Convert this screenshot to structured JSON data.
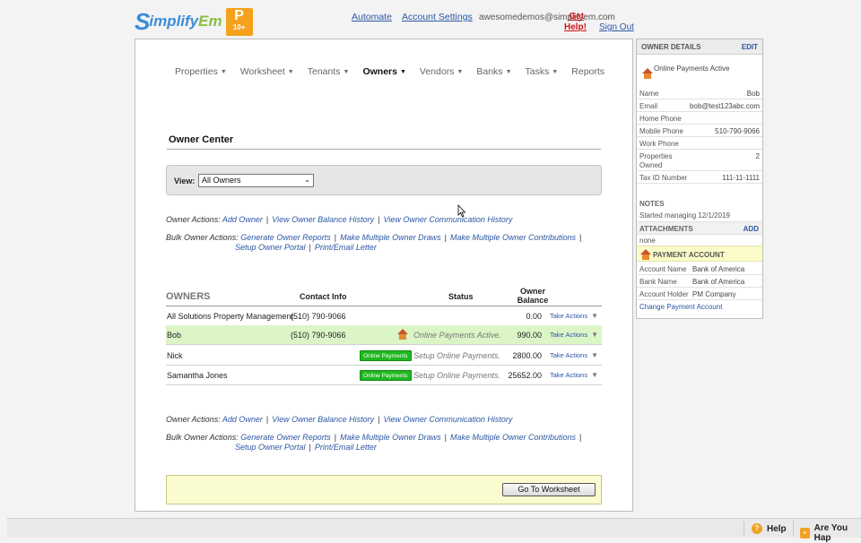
{
  "header": {
    "logo_s": "S",
    "logo_text_main": "implify",
    "logo_text_em": "Em",
    "badge_big": "P",
    "badge_small": "10+",
    "links": {
      "automate": "Automate",
      "account_settings": "Account Settings",
      "user_email": "awesomedemos@simplifyem.com",
      "get": "Get",
      "help": "Help!",
      "sign_out": "Sign Out"
    }
  },
  "menu": [
    {
      "label": "Properties",
      "caret": true
    },
    {
      "label": "Worksheet",
      "caret": true
    },
    {
      "label": "Tenants",
      "caret": true
    },
    {
      "label": "Owners",
      "caret": true,
      "active": true
    },
    {
      "label": "Vendors",
      "caret": true
    },
    {
      "label": "Banks",
      "caret": true
    },
    {
      "label": "Tasks",
      "caret": true
    },
    {
      "label": "Reports",
      "caret": false
    }
  ],
  "page": {
    "title": "Owner Center",
    "view_label": "View:",
    "view_value": "All Owners"
  },
  "owner_actions": {
    "label": "Owner Actions:",
    "links": [
      "Add Owner",
      "View Owner Balance History",
      "View Owner Communication History"
    ]
  },
  "bulk_actions": {
    "label": "Bulk Owner Actions:",
    "line1": [
      "Generate Owner Reports",
      "Make Multiple Owner Draws",
      "Make Multiple Owner Contributions"
    ],
    "line2": [
      "Setup Owner Portal",
      "Print/Email Letter"
    ]
  },
  "table": {
    "headers": {
      "owners": "OWNERS",
      "contact": "Contact Info",
      "status": "Status",
      "balance_line1": "Owner",
      "balance_line2": "Balance"
    },
    "rows": [
      {
        "name": "All Solutions Property Management",
        "phone": "(510) 790-9066",
        "status": "",
        "badge": "",
        "balance": "0.00",
        "action": "Take Actions",
        "highlight": false,
        "house": false
      },
      {
        "name": "Bob",
        "phone": "(510) 790-9066",
        "status": "Online Payments Active.",
        "badge": "",
        "balance": "990.00",
        "action": "Take Actions",
        "highlight": true,
        "house": true
      },
      {
        "name": "Nick",
        "phone": "",
        "status": "Setup Online Payments.",
        "badge": "Online Payments",
        "balance": "2800.00",
        "action": "Take Actions",
        "highlight": false,
        "house": false
      },
      {
        "name": "Samantha Jones",
        "phone": "",
        "status": "Setup Online Payments.",
        "badge": "Online Payments",
        "balance": "25652.00",
        "action": "Take Actions",
        "highlight": false,
        "house": false
      }
    ]
  },
  "bottom": {
    "goto_label": "Go To Worksheet"
  },
  "side": {
    "title": "OWNER DETAILS",
    "edit": "EDIT",
    "status": "Online Payments Active",
    "fields": [
      {
        "k": "Name",
        "v": "Bob"
      },
      {
        "k": "Email",
        "v": "bob@test123abc.com"
      },
      {
        "k": "Home Phone",
        "v": ""
      },
      {
        "k": "Mobile Phone",
        "v": "510-790-9066"
      },
      {
        "k": "Work Phone",
        "v": ""
      },
      {
        "k": "Properties Owned",
        "v": "2"
      },
      {
        "k": "Tax ID Number",
        "v": "111-11-1111"
      }
    ],
    "notes_label": "NOTES",
    "notes": "Started managing 12/1/2019",
    "attachments_label": "ATTACHMENTS",
    "attachments_add": "ADD",
    "attachments_value": "none",
    "payment_label": "PAYMENT ACCOUNT",
    "payment_fields": [
      {
        "k": "Account Name",
        "v": "Bank of America"
      },
      {
        "k": "Bank Name",
        "v": "Bank of America"
      },
      {
        "k": "Account Holder",
        "v": "PM Company"
      }
    ],
    "change_link": "Change Payment Account"
  },
  "bottom_bar": {
    "help": "Help",
    "happy": "Are You Hap"
  },
  "colors": {
    "link": "#2b57a3",
    "highlight_row": "#dcf5c7",
    "badge_green": "#1fb81f",
    "brand_blue": "#3a8ed8",
    "brand_orange": "#f6a11b"
  }
}
